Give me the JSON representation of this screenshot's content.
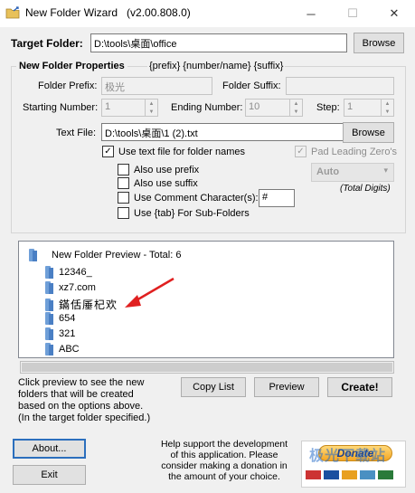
{
  "window": {
    "title": "New Folder Wizard   (v2.00.808.0)",
    "minimize_glyph": "─",
    "maximize_glyph": "☐",
    "close_glyph": "✕"
  },
  "target": {
    "label": "Target Folder:",
    "value": "D:\\tools\\桌面\\office",
    "browse_label": "Browse"
  },
  "properties": {
    "heading": "New Folder Properties",
    "format_hint": "{prefix} {number/name} {suffix}",
    "prefix_label": "Folder Prefix:",
    "prefix_value": "极光",
    "suffix_label": "Folder Suffix:",
    "suffix_value": "",
    "starting_label": "Starting Number:",
    "starting_value": "1",
    "ending_label": "Ending Number:",
    "ending_value": "10",
    "step_label": "Step:",
    "step_value": "1",
    "textfile_label": "Text File:",
    "textfile_value": "D:\\tools\\桌面\\1 (2).txt",
    "textfile_browse": "Browse",
    "use_text_file": "Use text file for folder names",
    "pad_leading": "Pad Leading Zero's",
    "pad_select": "Auto",
    "total_digits": "(Total Digits)",
    "also_prefix": "Also use prefix",
    "also_suffix": "Also use suffix",
    "use_comment": "Use Comment Character(s):",
    "comment_value": "#",
    "use_tab": "Use {tab} For Sub-Folders"
  },
  "preview": {
    "root": "New Folder Preview - Total: 6",
    "items": [
      "12346_",
      "xz7.com",
      "鏋佸厜杞欢",
      "654",
      "321",
      "ABC"
    ]
  },
  "info_text": {
    "line1": "Click preview to see the new",
    "line2": "folders that will be created",
    "line3": "based on the options above.",
    "line4": "(In the target folder specified.)"
  },
  "actions": {
    "copy_list": "Copy List",
    "preview": "Preview",
    "create": "Create!",
    "about": "About...",
    "exit": "Exit"
  },
  "support": {
    "line1": "Help support the development",
    "line2": "of this application. Please",
    "line3": "consider making a donation in",
    "line4": "the amount of your choice."
  },
  "donate": {
    "label": "Donate",
    "watermark": "极光下载站"
  },
  "colors": {
    "arrow": "#e02020",
    "default_button_border": "#2c6fbd",
    "folder_icon": "#4a7fc4"
  }
}
